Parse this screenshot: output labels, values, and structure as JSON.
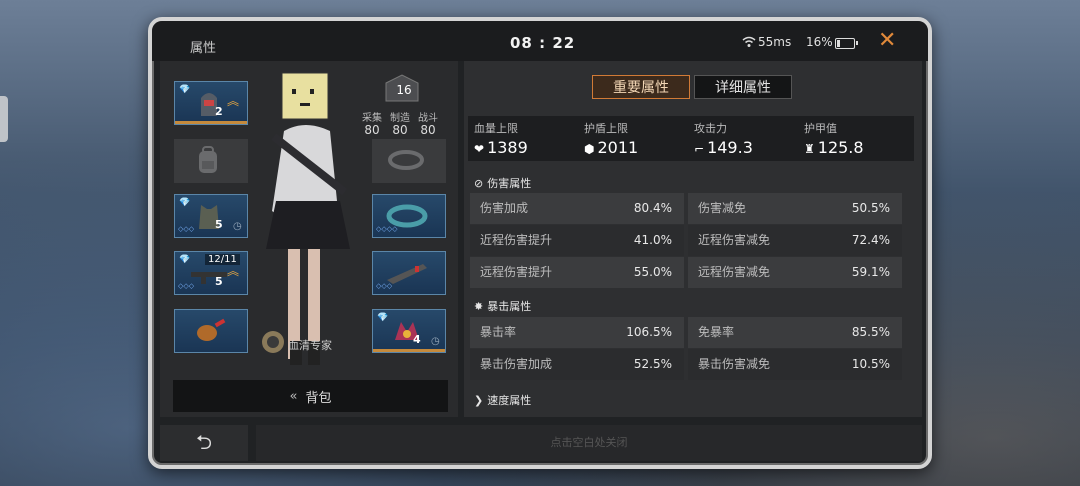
{
  "header": {
    "title": "属性",
    "clock": "08 : 22",
    "ping": "55ms",
    "battery": "16%",
    "battery_level": 0.16,
    "close": "✕"
  },
  "left": {
    "level": "16",
    "skills": [
      {
        "label": "采集",
        "value": "80"
      },
      {
        "label": "制造",
        "value": "80"
      },
      {
        "label": "战斗",
        "value": "80"
      }
    ],
    "slots": {
      "helmet": {
        "num": "2",
        "diamond": "💎"
      },
      "weapon1": {
        "num": "5"
      },
      "weapon2": {
        "ammo": "12/11",
        "num": "5"
      },
      "mod": {
        "num": "4"
      }
    },
    "badge_label": "血清专家",
    "bag_label": "背包",
    "bag_icon": "«"
  },
  "tabs": {
    "primary": "重要属性",
    "detail": "详细属性"
  },
  "summary": [
    {
      "label": "血量上限",
      "value": "1389",
      "icon": "heart-icon",
      "glyph": "❤"
    },
    {
      "label": "护盾上限",
      "value": "2011",
      "icon": "shield-icon",
      "glyph": "⬢"
    },
    {
      "label": "攻击力",
      "value": "149.3",
      "icon": "gun-icon",
      "glyph": "⌐"
    },
    {
      "label": "护甲值",
      "value": "125.8",
      "icon": "armor-icon",
      "glyph": "♜"
    }
  ],
  "sections": {
    "damage": {
      "title": "伤害属性",
      "glyph": "⊘"
    },
    "crit": {
      "title": "暴击属性",
      "glyph": "✸"
    },
    "speed": {
      "title": "速度属性",
      "glyph": "❯"
    }
  },
  "damage_rows": [
    [
      {
        "k": "伤害加成",
        "v": "80.4%"
      },
      {
        "k": "伤害减免",
        "v": "50.5%"
      }
    ],
    [
      {
        "k": "近程伤害提升",
        "v": "41.0%"
      },
      {
        "k": "近程伤害减免",
        "v": "72.4%"
      }
    ],
    [
      {
        "k": "远程伤害提升",
        "v": "55.0%"
      },
      {
        "k": "远程伤害减免",
        "v": "59.1%"
      }
    ]
  ],
  "crit_rows": [
    [
      {
        "k": "暴击率",
        "v": "106.5%"
      },
      {
        "k": "免暴率",
        "v": "85.5%"
      }
    ],
    [
      {
        "k": "暴击伤害加成",
        "v": "52.5%"
      },
      {
        "k": "暴击伤害减免",
        "v": "10.5%"
      }
    ]
  ],
  "footer": {
    "back_glyph": "⮌",
    "hint": "点击空白处关闭"
  },
  "colors": {
    "accent": "#d17a36",
    "slot_blue": "#27496a"
  }
}
